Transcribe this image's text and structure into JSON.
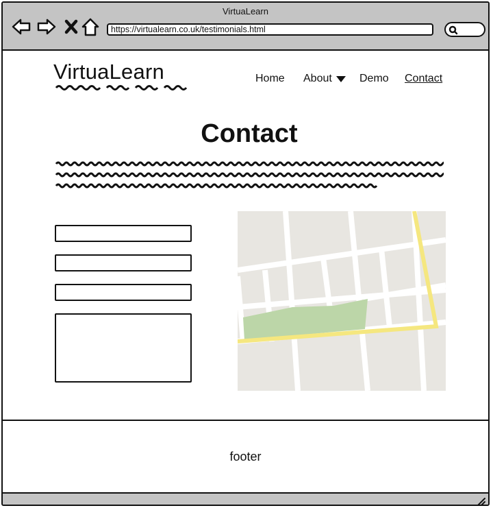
{
  "browser": {
    "window_title": "VirtuaLearn",
    "url": "https://virtualearn.co.uk/testimonials.html",
    "icons": [
      "back-arrow-icon",
      "forward-arrow-icon",
      "close-x-icon",
      "home-icon",
      "search-icon",
      "resize-grip-icon"
    ]
  },
  "site": {
    "logo": "VirtuaLearn",
    "nav": [
      {
        "label": "Home",
        "active": false
      },
      {
        "label": "About",
        "active": false,
        "has_dropdown": true
      },
      {
        "label": "Demo",
        "active": false
      },
      {
        "label": "Contact",
        "active": true
      }
    ]
  },
  "main": {
    "title": "Contact",
    "form_fields": [
      "text-field",
      "text-field",
      "text-field",
      "textarea"
    ]
  },
  "map": {
    "colors": {
      "land": "#e8e6e1",
      "road": "#ffffff",
      "highway": "#f5e77f",
      "park": "#bcd6a8"
    }
  },
  "footer": {
    "text": "footer"
  },
  "colors": {
    "chrome": "#c4c4c4",
    "stroke": "#111111"
  }
}
